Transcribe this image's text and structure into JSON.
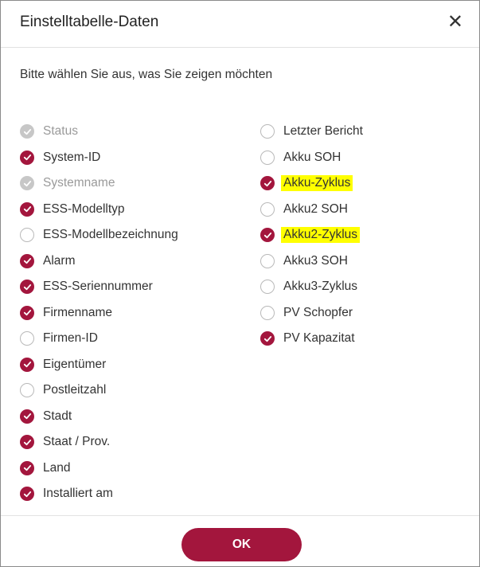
{
  "dialog": {
    "title": "Einstelltabelle-Daten",
    "close_icon": "close-icon",
    "subtitle": "Bitte wählen Sie aus, was Sie zeigen möchten",
    "ok_label": "OK"
  },
  "colors": {
    "accent": "#a3163d",
    "disabled": "#c7c7c7",
    "highlight": "#ffff00"
  },
  "left_items": [
    {
      "label": "Status",
      "state": "disabled"
    },
    {
      "label": "System-ID",
      "state": "checked"
    },
    {
      "label": "Systemname",
      "state": "disabled"
    },
    {
      "label": "ESS-Modelltyp",
      "state": "checked"
    },
    {
      "label": "ESS-Modellbezeichnung",
      "state": "unchecked"
    },
    {
      "label": "Alarm",
      "state": "checked"
    },
    {
      "label": "ESS-Seriennummer",
      "state": "checked"
    },
    {
      "label": "Firmenname",
      "state": "checked"
    },
    {
      "label": "Firmen-ID",
      "state": "unchecked"
    },
    {
      "label": "Eigentümer",
      "state": "checked"
    },
    {
      "label": "Postleitzahl",
      "state": "unchecked"
    },
    {
      "label": "Stadt",
      "state": "checked"
    },
    {
      "label": "Staat / Prov.",
      "state": "checked"
    },
    {
      "label": "Land",
      "state": "checked"
    },
    {
      "label": "Installiert am",
      "state": "checked"
    }
  ],
  "right_items": [
    {
      "label": "Letzter Bericht",
      "state": "unchecked"
    },
    {
      "label": "Akku SOH",
      "state": "unchecked"
    },
    {
      "label": "Akku-Zyklus",
      "state": "checked",
      "highlighted": true
    },
    {
      "label": "Akku2 SOH",
      "state": "unchecked"
    },
    {
      "label": "Akku2-Zyklus",
      "state": "checked",
      "highlighted": true
    },
    {
      "label": "Akku3 SOH",
      "state": "unchecked"
    },
    {
      "label": "Akku3-Zyklus",
      "state": "unchecked"
    },
    {
      "label": "PV Schopfer",
      "state": "unchecked"
    },
    {
      "label": "PV Kapazitat",
      "state": "checked"
    }
  ]
}
